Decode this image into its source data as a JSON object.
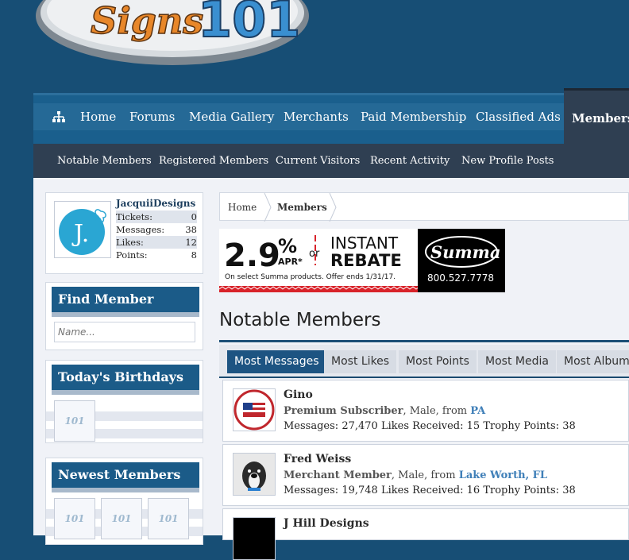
{
  "logo": {
    "text_script": "Signs",
    "text_num": "101"
  },
  "nav": {
    "items": [
      "Home",
      "Forums",
      "Media Gallery",
      "Merchants",
      "Paid Membership",
      "Classified Ads",
      "Members"
    ]
  },
  "subnav": {
    "items": [
      "Notable Members",
      "Registered Members",
      "Current Visitors",
      "Recent Activity",
      "New Profile Posts"
    ]
  },
  "visitor": {
    "username": "JacquiiDesigns",
    "avatar_letter": "J.",
    "rows": [
      {
        "label": "Tickets:",
        "value": "0"
      },
      {
        "label": "Messages:",
        "value": "38"
      },
      {
        "label": "Likes:",
        "value": "12"
      },
      {
        "label": "Points:",
        "value": "8"
      }
    ]
  },
  "find_member": {
    "title": "Find Member",
    "placeholder": "Name..."
  },
  "birthdays": {
    "title": "Today's Birthdays"
  },
  "newest": {
    "title": "Newest Members"
  },
  "breadcrumb": {
    "home": "Home",
    "current": "Members"
  },
  "ad": {
    "rate": "2.9",
    "pct": "%",
    "apr": "APR*",
    "or": "or",
    "instant": "INSTANT",
    "rebate": "REBATE",
    "fine": "On select Summa products. Offer ends 1/31/17.",
    "brand": "Summa",
    "phone": "800.527.7778"
  },
  "page": {
    "title": "Notable Members"
  },
  "tabs": [
    "Most Messages",
    "Most Likes",
    "Most Points",
    "Most Media",
    "Most Albums"
  ],
  "members": [
    {
      "name": "Gino",
      "title": "Premium Subscriber",
      "gender": ", Male, from ",
      "location": "PA",
      "messages_label": "Messages:",
      "messages": "27,470",
      "likes_label": "Likes Received:",
      "likes": "15",
      "trophy_label": "Trophy Points:",
      "trophy": "38"
    },
    {
      "name": "Fred Weiss",
      "title": "Merchant Member",
      "gender": ", Male, from ",
      "location": "Lake Worth, FL",
      "messages_label": "Messages:",
      "messages": "19,748",
      "likes_label": "Likes Received:",
      "likes": "16",
      "trophy_label": "Trophy Points:",
      "trophy": "38"
    },
    {
      "name": "J Hill Designs"
    }
  ],
  "colors": {
    "bg": "#174e75",
    "nav": "#256996",
    "nav_selected": "#2f3f52",
    "accent": "#1b5b88",
    "link": "#3f7fb8"
  }
}
